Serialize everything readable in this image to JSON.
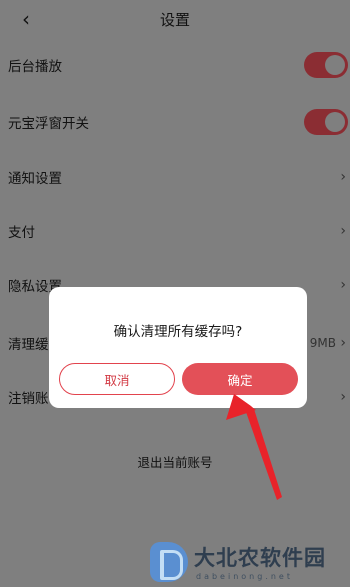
{
  "header": {
    "title": "设置",
    "back_icon": "chevron-left-icon",
    "back_glyph": "‹"
  },
  "rows": [
    {
      "label": "后台播放",
      "type": "toggle",
      "on": true
    },
    {
      "label": "元宝浮窗开关",
      "type": "toggle",
      "on": true
    },
    {
      "label": "通知设置",
      "type": "link",
      "chevron": "›"
    },
    {
      "label": "支付",
      "type": "link",
      "chevron": "›"
    },
    {
      "label": "隐私设置",
      "type": "link",
      "chevron": "›"
    },
    {
      "label": "清理缓存",
      "type": "link",
      "value": "9MB",
      "chevron": "›"
    },
    {
      "label": "注销账号",
      "type": "link",
      "chevron": "›"
    }
  ],
  "logout": {
    "label": "退出当前账号"
  },
  "dialog": {
    "message": "确认清理所有缓存吗?",
    "cancel_label": "取消",
    "confirm_label": "确定"
  },
  "colors": {
    "accent": "#e35058",
    "toggle_on": "#8b2d33",
    "overlay": "#7f7f7f",
    "annotation_arrow": "#e8232a"
  },
  "watermark": {
    "cn": "大北农软件园",
    "en": "dabeinong.net"
  }
}
